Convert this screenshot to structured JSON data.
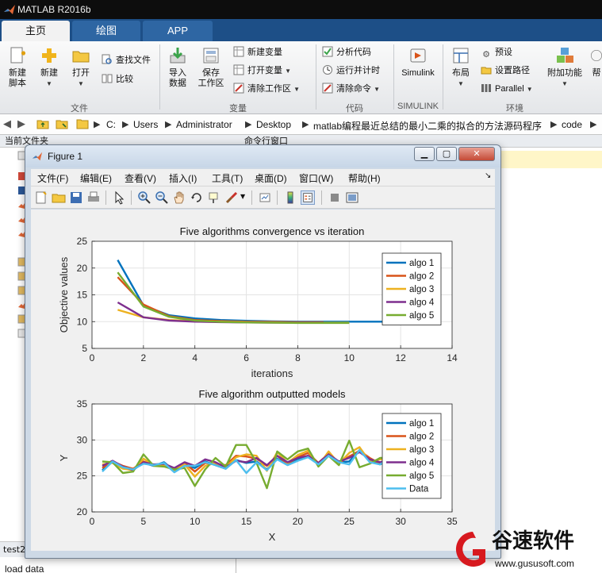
{
  "app": {
    "title": "MATLAB R2016b"
  },
  "tabs": [
    {
      "label": "主页"
    },
    {
      "label": "绘图"
    },
    {
      "label": "APP"
    }
  ],
  "ribbon": {
    "new_script": "新建\n脚本",
    "new_script_l1": "新建",
    "new_script_l2": "脚本",
    "new": "新建",
    "open": "打开",
    "find_files": "查找文件",
    "compare": "比较",
    "import_l1": "导入",
    "import_l2": "数据",
    "save_l1": "保存",
    "save_l2": "工作区",
    "new_var": "新建变量",
    "open_var": "打开变量",
    "clear_ws": "清除工作区",
    "analyze_code": "分析代码",
    "run_time": "运行并计时",
    "clear_cmd": "清除命令",
    "simulink": "Simulink",
    "layout": "布局",
    "preferences": "预设",
    "set_path": "设置路径",
    "parallel": "Parallel",
    "addons": "附加功能",
    "help_partial": "帮",
    "groups": {
      "file": "文件",
      "variable": "变量",
      "code": "代码",
      "simulink": "SIMULINK",
      "environment": "环境"
    }
  },
  "address": {
    "crumbs": [
      "C:",
      "Users",
      "Administrator",
      "Desktop",
      "matlab编程最近总结的最小二乘的拟合的方法源码程序",
      "code"
    ]
  },
  "left_panel": {
    "header": "当前文件夹",
    "bottom_tab": "test2",
    "bottom_text": "load data"
  },
  "command_window": {
    "header": "命令行窗口"
  },
  "figure": {
    "title": "Figure 1",
    "menus": [
      "文件(F)",
      "编辑(E)",
      "查看(V)",
      "插入(I)",
      "工具(T)",
      "桌面(D)",
      "窗口(W)",
      "帮助(H)"
    ]
  },
  "colors": {
    "algo1": "#0072bd",
    "algo2": "#d95319",
    "algo3": "#edb120",
    "algo4": "#7e2f8e",
    "algo5": "#77ac30",
    "data": "#4dbeee"
  },
  "chart_data": [
    {
      "type": "line",
      "title": "Five algorithms convergence vs iteration",
      "xlabel": "iterations",
      "ylabel": "Objective values",
      "xlim": [
        0,
        14
      ],
      "ylim": [
        5,
        25
      ],
      "xticks": [
        0,
        2,
        4,
        6,
        8,
        10,
        12,
        14
      ],
      "yticks": [
        5,
        10,
        15,
        20,
        25
      ],
      "grid": true,
      "legend_position": "top-right",
      "series": [
        {
          "name": "algo 1",
          "x": [
            1,
            2,
            3,
            4,
            5,
            6,
            7,
            8,
            9,
            10,
            11,
            12,
            13
          ],
          "values": [
            21.5,
            13.0,
            11.2,
            10.6,
            10.3,
            10.15,
            10.05,
            10.0,
            10.0,
            10.0,
            10.0,
            10.0,
            10.0
          ]
        },
        {
          "name": "algo 2",
          "x": [
            1,
            2,
            3,
            4,
            5,
            6,
            7,
            8,
            9
          ],
          "values": [
            18.3,
            13.2,
            11.0,
            10.3,
            10.1,
            10.0,
            9.95,
            9.9,
            9.9
          ]
        },
        {
          "name": "algo 3",
          "x": [
            1,
            2,
            3,
            4,
            5,
            6,
            7,
            8,
            9,
            10
          ],
          "values": [
            12.2,
            10.8,
            10.3,
            10.1,
            10.0,
            9.9,
            9.85,
            9.8,
            9.8,
            9.8
          ]
        },
        {
          "name": "algo 4",
          "x": [
            1,
            2,
            3,
            4,
            5,
            6,
            7,
            8,
            9
          ],
          "values": [
            13.6,
            10.8,
            10.2,
            10.0,
            9.9,
            9.85,
            9.8,
            9.8,
            9.8
          ]
        },
        {
          "name": "algo 5",
          "x": [
            1,
            2,
            3,
            4,
            5,
            6,
            7,
            8,
            9,
            10
          ],
          "values": [
            19.2,
            12.8,
            10.9,
            10.2,
            9.95,
            9.85,
            9.8,
            9.75,
            9.75,
            9.75
          ]
        }
      ]
    },
    {
      "type": "line",
      "title": "Five algorithm outputted models",
      "xlabel": "X",
      "ylabel": "Y",
      "xlim": [
        0,
        35
      ],
      "ylim": [
        20,
        35
      ],
      "xticks": [
        0,
        5,
        10,
        15,
        20,
        25,
        30,
        35
      ],
      "yticks": [
        20,
        25,
        30,
        35
      ],
      "grid": true,
      "legend_position": "top-right",
      "x": [
        1,
        2,
        3,
        4,
        5,
        6,
        7,
        8,
        9,
        10,
        11,
        12,
        13,
        14,
        15,
        16,
        17,
        18,
        19,
        20,
        21,
        22,
        23,
        24,
        25,
        26,
        27,
        28,
        29
      ],
      "series": [
        {
          "name": "algo 1",
          "values": [
            25.8,
            27.0,
            26.2,
            25.9,
            26.8,
            26.4,
            26.9,
            25.7,
            26.6,
            26.1,
            27.0,
            26.5,
            26.0,
            27.2,
            26.8,
            27.0,
            25.9,
            27.4,
            26.6,
            27.3,
            27.8,
            26.6,
            27.9,
            26.9,
            27.0,
            28.6,
            27.3,
            26.6,
            27.2
          ]
        },
        {
          "name": "algo 2",
          "values": [
            26.1,
            27.0,
            26.4,
            26.0,
            27.0,
            26.5,
            26.6,
            26.0,
            26.8,
            25.6,
            26.8,
            26.6,
            26.5,
            27.8,
            27.7,
            27.4,
            26.4,
            27.8,
            26.7,
            27.6,
            28.2,
            26.8,
            28.1,
            26.8,
            27.7,
            28.5,
            27.5,
            26.7,
            27.1
          ]
        },
        {
          "name": "algo 3",
          "values": [
            26.6,
            26.8,
            26.0,
            25.8,
            27.4,
            26.5,
            26.4,
            25.8,
            26.6,
            24.9,
            26.4,
            26.8,
            26.2,
            27.6,
            28.0,
            27.8,
            25.7,
            28.3,
            26.8,
            27.9,
            28.5,
            26.4,
            28.4,
            26.7,
            28.2,
            29.0,
            27.0,
            27.3,
            27.4
          ]
        },
        {
          "name": "algo 4",
          "values": [
            26.4,
            27.1,
            26.3,
            25.8,
            26.9,
            26.6,
            26.7,
            26.1,
            26.9,
            26.4,
            27.3,
            26.9,
            26.2,
            27.1,
            26.9,
            27.5,
            26.5,
            27.8,
            26.9,
            27.5,
            27.8,
            26.8,
            28.0,
            27.0,
            27.5,
            28.3,
            27.3,
            26.9,
            27.3
          ]
        },
        {
          "name": "algo 5",
          "values": [
            27.0,
            26.9,
            25.4,
            25.6,
            28.0,
            26.4,
            26.3,
            25.9,
            26.1,
            23.6,
            25.9,
            27.5,
            26.3,
            29.3,
            29.3,
            26.8,
            23.3,
            28.4,
            27.3,
            28.4,
            28.8,
            26.3,
            27.8,
            26.5,
            29.9,
            26.2,
            26.7,
            27.5,
            27.5
          ]
        },
        {
          "name": "Data",
          "values": [
            25.6,
            27.0,
            26.2,
            25.9,
            26.7,
            26.5,
            26.8,
            25.5,
            26.4,
            26.4,
            26.9,
            26.5,
            26.0,
            27.2,
            25.4,
            26.9,
            25.8,
            27.3,
            26.5,
            27.1,
            27.6,
            26.6,
            27.8,
            26.9,
            26.6,
            28.6,
            26.9,
            26.6,
            27.6
          ]
        }
      ]
    }
  ],
  "watermark": {
    "brand": "谷速软件",
    "url": "www.gususoft.com"
  }
}
